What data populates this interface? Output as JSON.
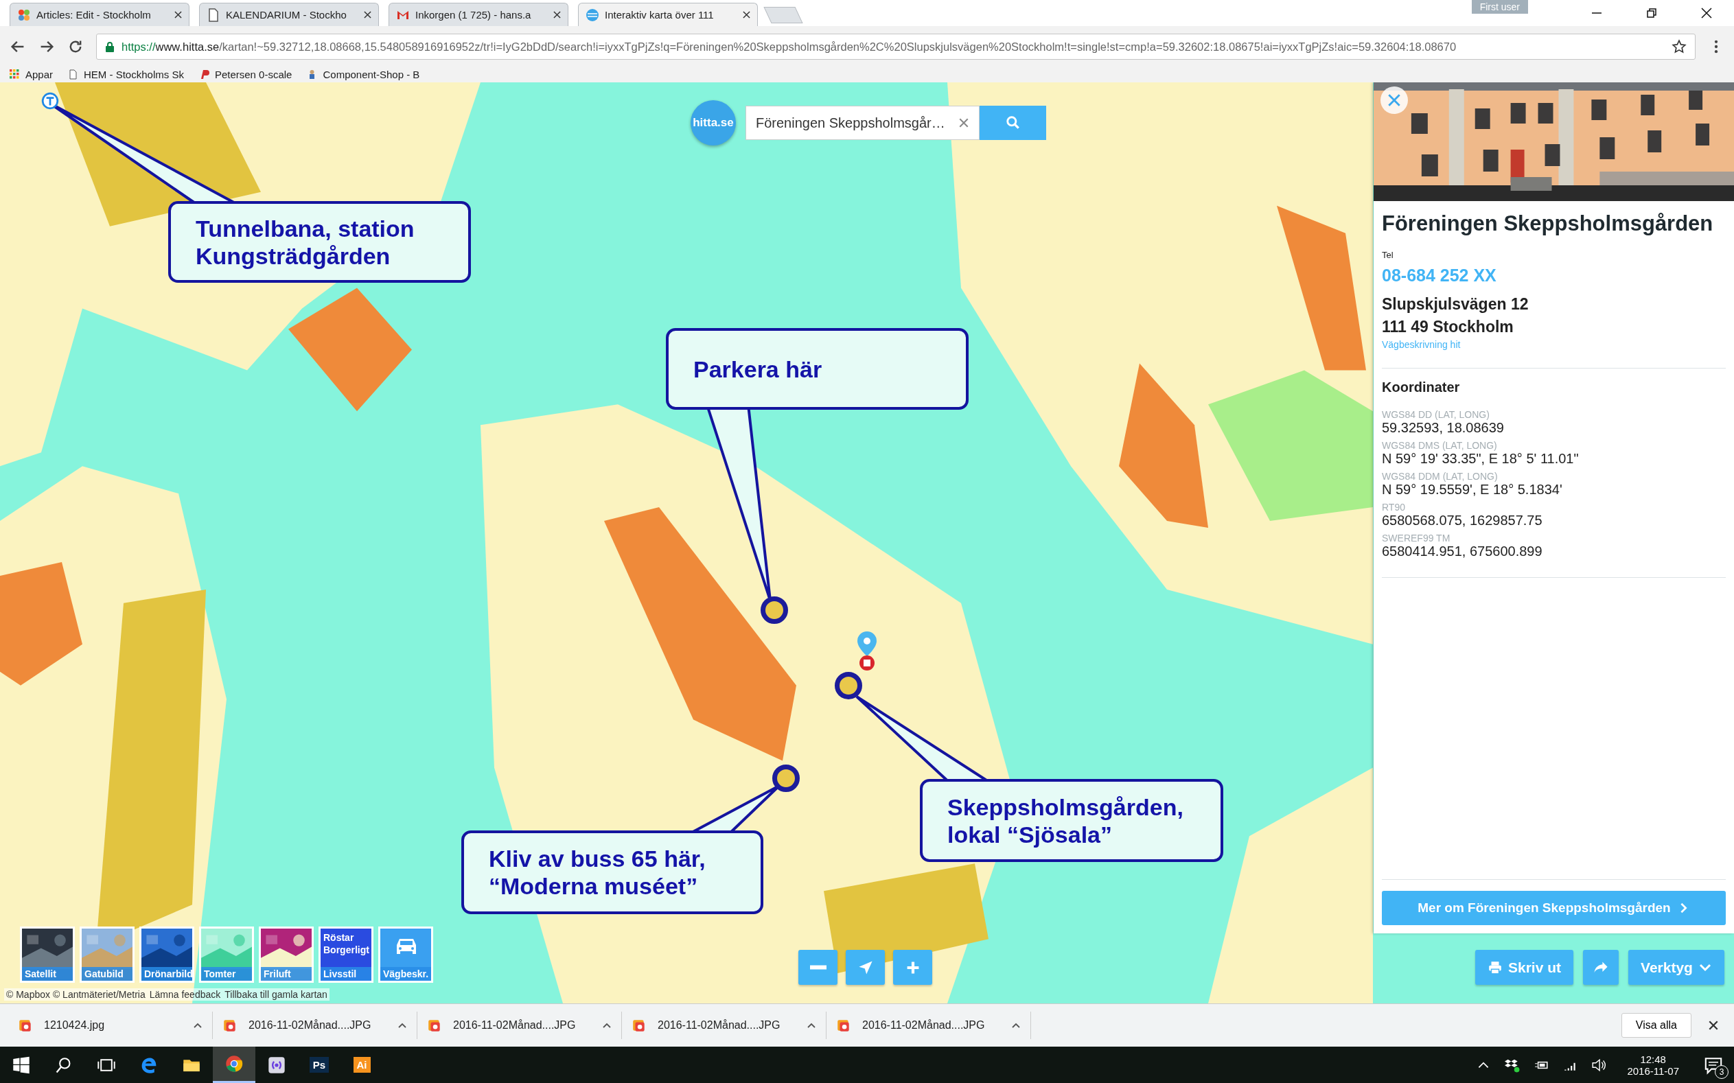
{
  "browser": {
    "tabs": [
      {
        "title": "Articles: Edit - Stockholm",
        "selected": false
      },
      {
        "title": "KALENDARIUM - Stockho",
        "selected": false
      },
      {
        "title": "Inkorgen (1 725) - hans.a",
        "selected": false
      },
      {
        "title": "Interaktiv karta över 111",
        "selected": true
      }
    ],
    "user_badge": "First user",
    "url": {
      "scheme": "https://",
      "host": "www.hitta.se",
      "path": "/kartan!~59.32712,18.08668,15.548058916916952z/tr!i=IyG2bDdD/search!i=iyxxTgPjZs!q=Föreningen%20Skeppsholmsgården%2C%20Slupskjulsvägen%20Stockholm!t=single!st=cmp!a=59.32602:18.08675!ai=iyxxTgPjZs!aic=59.32604:18.08670"
    },
    "bookmarks": [
      {
        "label": "Appar"
      },
      {
        "label": "HEM - Stockholms Sk"
      },
      {
        "label": "Petersen 0-scale"
      },
      {
        "label": "Component-Shop - B"
      }
    ]
  },
  "map": {
    "logo": "hitta.se",
    "search": {
      "value": "Föreningen Skeppsholmsgår…"
    },
    "callouts": [
      {
        "lines": [
          "Tunnelbana, station",
          "Kungsträdgården"
        ]
      },
      {
        "lines": [
          "Parkera här"
        ]
      },
      {
        "lines": [
          "Skeppsholmsgården,",
          "lokal “Sjösala”"
        ]
      },
      {
        "lines": [
          "Kliv av buss 65 här,",
          "“Moderna muséet”"
        ]
      }
    ],
    "layers": [
      {
        "label": "Satellit",
        "kind": "picture"
      },
      {
        "label": "Gatubild",
        "kind": "picture"
      },
      {
        "label": "Drönarbild",
        "kind": "picture"
      },
      {
        "label": "Tomter",
        "kind": "picture"
      },
      {
        "label": "Friluft",
        "kind": "picture"
      },
      {
        "label": "Livsstil",
        "kind": "text",
        "text": "Röstar Borgerligt"
      },
      {
        "label": "Vägbeskr.",
        "kind": "car"
      }
    ],
    "attribution": {
      "text": "© Mapbox © Lantmäteriet/Metria",
      "links": [
        "Lämna feedback",
        "Tillbaka till gamla kartan"
      ]
    },
    "tools": {
      "print": "Skriv ut",
      "menu": "Verktyg"
    }
  },
  "panel": {
    "name": "Föreningen Skeppsholmsgården",
    "tel_label": "Tel",
    "phone": "08-684 252 XX",
    "street": "Slupskjulsvägen 12",
    "city": "111 49 Stockholm",
    "directions": "Vägbeskrivning hit",
    "coords_heading": "Koordinater",
    "coords": [
      {
        "label": "WGS84 DD (LAT, LONG)",
        "value": "59.32593, 18.08639"
      },
      {
        "label": "WGS84 DMS (LAT, LONG)",
        "value": "N 59° 19' 33.35\", E 18° 5' 11.01\""
      },
      {
        "label": "WGS84 DDM (LAT, LONG)",
        "value": "N 59° 19.5559', E 18° 5.1834'"
      },
      {
        "label": "RT90",
        "value": "6580568.075, 1629857.75"
      },
      {
        "label": "SWEREF99 TM",
        "value": "6580414.951, 675600.899"
      }
    ],
    "more_button": "Mer om Föreningen Skeppsholmsgården"
  },
  "downloads": {
    "items": [
      "1210424.jpg",
      "2016-11-02Månad....JPG",
      "2016-11-02Månad....JPG",
      "2016-11-02Månad....JPG",
      "2016-11-02Månad....JPG"
    ],
    "show_all": "Visa alla"
  },
  "taskbar": {
    "apps": [
      {
        "kind": "windows"
      },
      {
        "kind": "search"
      },
      {
        "kind": "taskview"
      },
      {
        "kind": "edge"
      },
      {
        "kind": "folder"
      },
      {
        "kind": "chrome",
        "selected": true
      },
      {
        "kind": "podcast"
      },
      {
        "kind": "label",
        "text": "Ps",
        "color": "#0b2a4a"
      },
      {
        "kind": "label",
        "text": "Ai",
        "color": "#f7931e"
      }
    ],
    "time": "12:48",
    "date": "2016-11-07",
    "notifications": "3"
  }
}
